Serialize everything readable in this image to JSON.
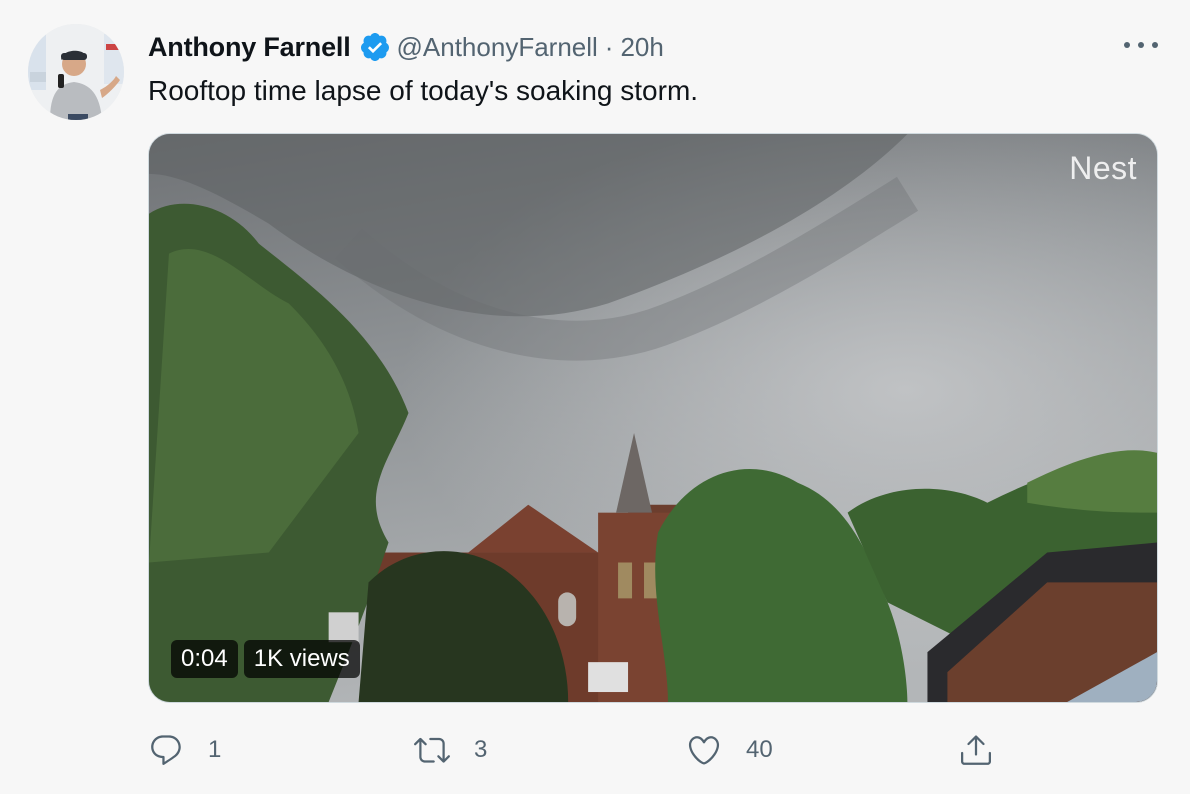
{
  "author": {
    "display_name": "Anthony Farnell",
    "handle": "@AnthonyFarnell",
    "verified": true,
    "verified_color": "#1d9bf0"
  },
  "meta": {
    "separator": "·",
    "time": "20h"
  },
  "tweet": {
    "text": "Rooftop time lapse of today's soaking storm."
  },
  "media": {
    "watermark": "Nest",
    "duration": "0:04",
    "views": "1K views"
  },
  "actions": {
    "reply": {
      "icon": "reply-icon",
      "count": "1"
    },
    "retweet": {
      "icon": "retweet-icon",
      "count": "3"
    },
    "like": {
      "icon": "heart-icon",
      "count": "40"
    },
    "share": {
      "icon": "share-icon"
    }
  },
  "colors": {
    "secondary_text": "#536471",
    "background": "#f7f7f7"
  }
}
